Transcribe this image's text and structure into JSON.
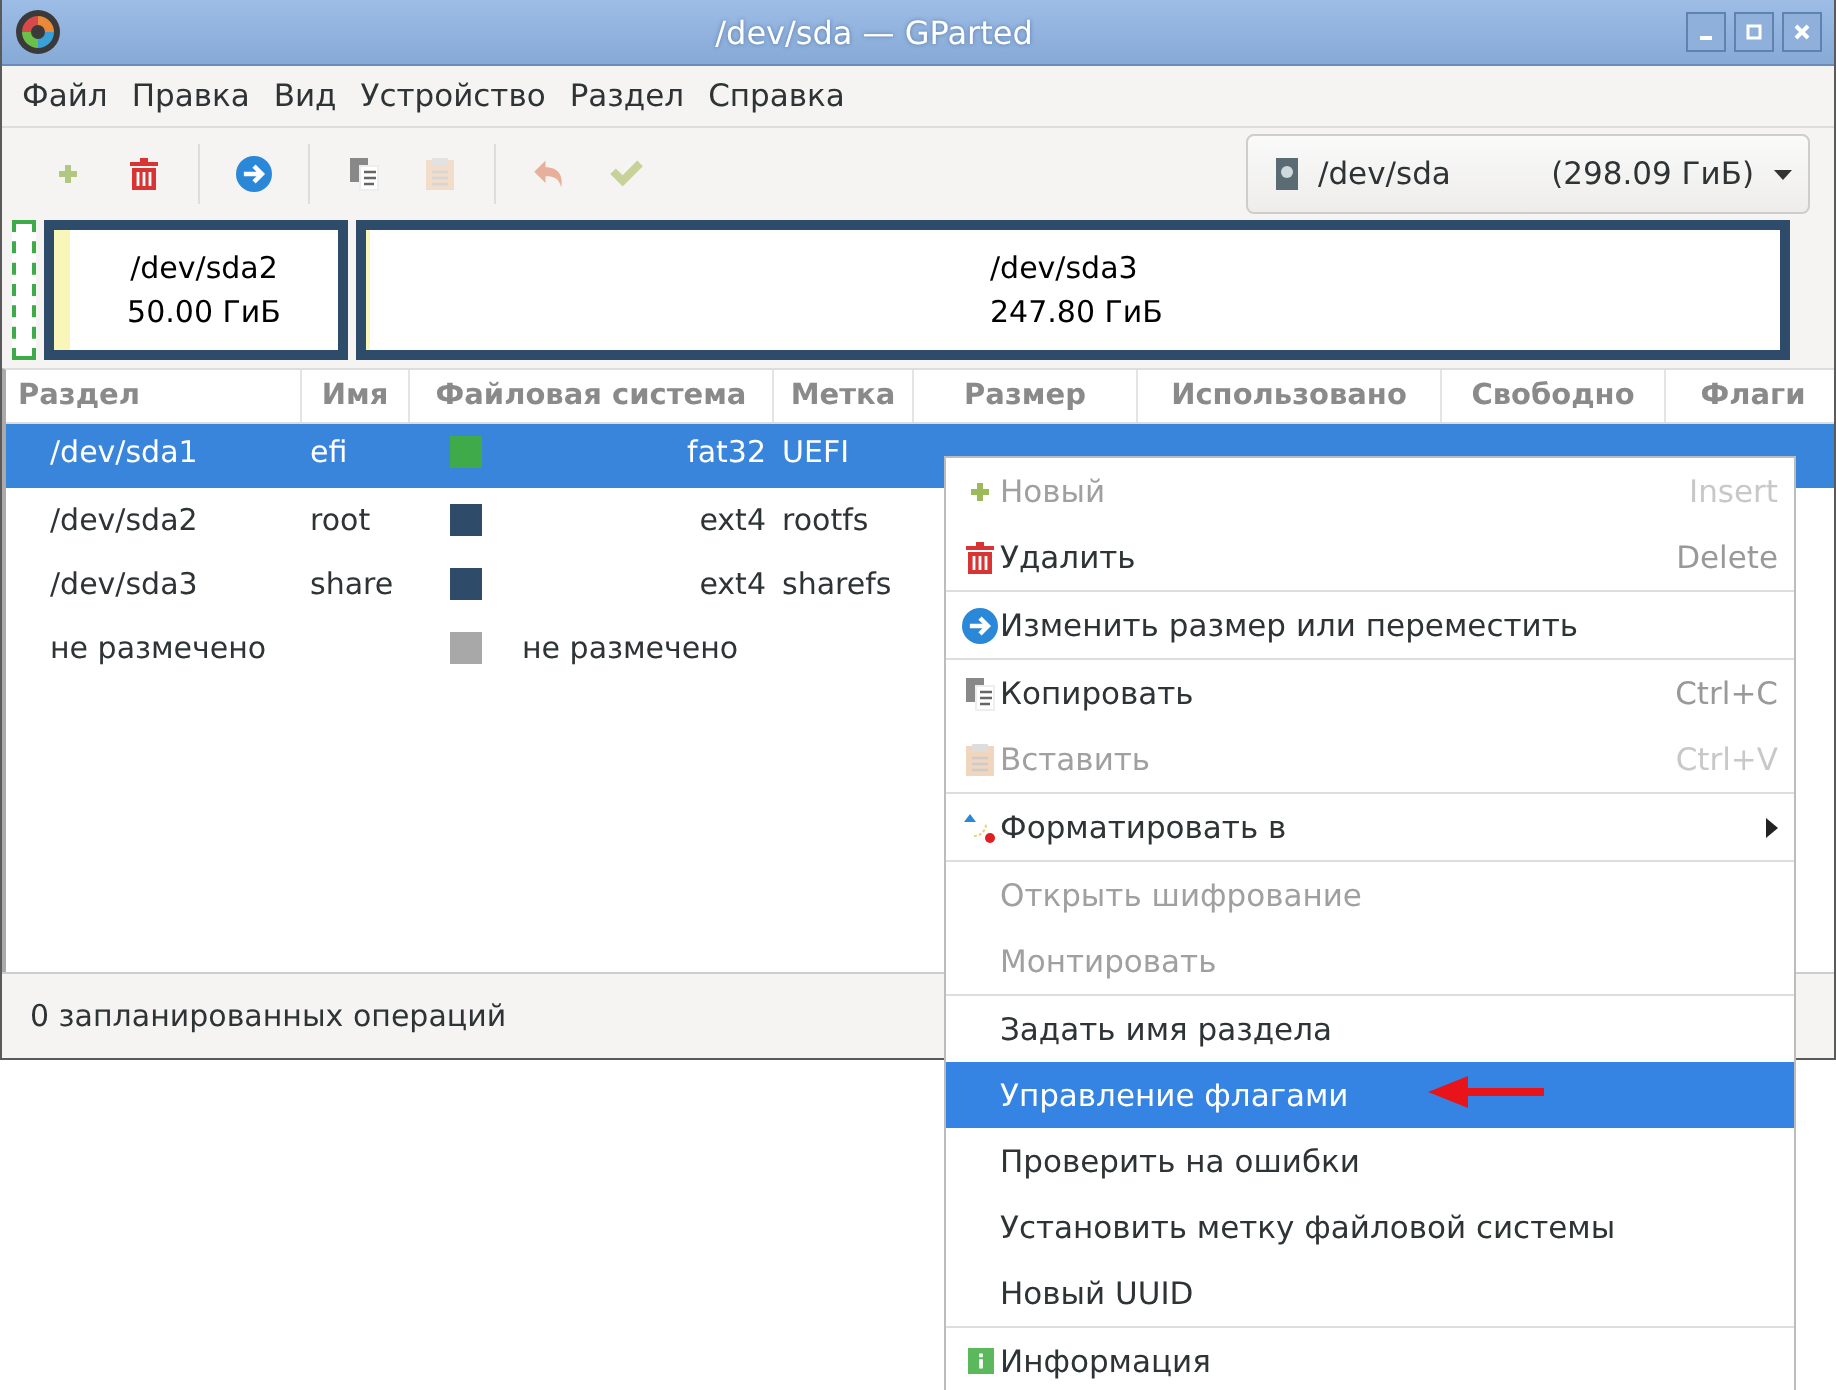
{
  "window": {
    "title": "/dev/sda — GParted"
  },
  "menubar": [
    "Файл",
    "Правка",
    "Вид",
    "Устройство",
    "Раздел",
    "Справка"
  ],
  "toolbar": [
    {
      "kind": "new",
      "disabled": true
    },
    {
      "kind": "delete",
      "disabled": false
    },
    {
      "kind": "separator"
    },
    {
      "kind": "resize",
      "disabled": false
    },
    {
      "kind": "separator"
    },
    {
      "kind": "copy",
      "disabled": false
    },
    {
      "kind": "paste",
      "disabled": true
    },
    {
      "kind": "separator"
    },
    {
      "kind": "undo",
      "disabled": true
    },
    {
      "kind": "apply",
      "disabled": true
    }
  ],
  "device_selector": {
    "device": "/dev/sda",
    "size": "(298.09 ГиБ)"
  },
  "disk_map": [
    {
      "selected": true,
      "color": "#3faa4a"
    },
    {
      "label": "/dev/sda2",
      "size": "50.00 ГиБ",
      "selected": false,
      "color": "#2f4b6a",
      "level": 0.02
    },
    {
      "label": "/dev/sda3",
      "size": "247.80 ГиБ",
      "selected": false,
      "color": "#2f4b6a",
      "level": 0.005
    }
  ],
  "table": {
    "columns": [
      "Раздел",
      "Имя",
      "Файловая система",
      "Метка",
      "Размер",
      "Использовано",
      "Свободно",
      "Флаги"
    ],
    "rows": [
      {
        "partition": "/dev/sda1",
        "name": "efi",
        "color": "#3faa4a",
        "filesystem": "fat32",
        "label": "UEFI",
        "selected": true
      },
      {
        "partition": "/dev/sda2",
        "name": "root",
        "color": "#2f4b6a",
        "filesystem": "ext4",
        "label": "rootfs",
        "selected": false
      },
      {
        "partition": "/dev/sda3",
        "name": "share",
        "color": "#2f4b6a",
        "filesystem": "ext4",
        "label": "sharefs",
        "selected": false
      },
      {
        "partition": "не размечено",
        "color": "#a8a8a8",
        "filesystem": "не размечено",
        "selected": false,
        "kind": "unallocated"
      }
    ]
  },
  "status_bar": "0 запланированных операций",
  "context_menu": [
    {
      "kind": "new",
      "label": "Новый",
      "shortcut": "Insert",
      "disabled": true,
      "selected": false
    },
    {
      "kind": "delete",
      "label": "Удалить",
      "shortcut": "Delete",
      "disabled": false,
      "selected": false
    },
    {
      "kind": "separator"
    },
    {
      "kind": "resize",
      "label": "Изменить размер или переместить",
      "disabled": false,
      "selected": false
    },
    {
      "kind": "separator"
    },
    {
      "kind": "copy",
      "label": "Копировать",
      "shortcut": "Ctrl+C",
      "disabled": false,
      "selected": false
    },
    {
      "kind": "paste",
      "label": "Вставить",
      "shortcut": "Ctrl+V",
      "disabled": true,
      "selected": false
    },
    {
      "kind": "separator"
    },
    {
      "kind": "format",
      "label": "Форматировать в",
      "submenu": true,
      "disabled": false,
      "selected": false
    },
    {
      "kind": "separator"
    },
    {
      "kind": "plain",
      "label": "Открыть шифрование",
      "disabled": true,
      "selected": false
    },
    {
      "kind": "plain",
      "label": "Монтировать",
      "disabled": true,
      "selected": false
    },
    {
      "kind": "separator"
    },
    {
      "kind": "plain",
      "label": "Задать имя раздела",
      "disabled": false,
      "selected": false
    },
    {
      "kind": "plain",
      "label": "Управление флагами",
      "disabled": false,
      "selected": true
    },
    {
      "kind": "plain",
      "label": "Проверить на ошибки",
      "disabled": false,
      "selected": false
    },
    {
      "kind": "plain",
      "label": "Установить метку файловой системы",
      "disabled": false,
      "selected": false
    },
    {
      "kind": "plain",
      "label": "Новый UUID",
      "disabled": false,
      "selected": false
    },
    {
      "kind": "separator"
    },
    {
      "kind": "info",
      "label": "Информация",
      "disabled": false,
      "selected": false
    }
  ]
}
